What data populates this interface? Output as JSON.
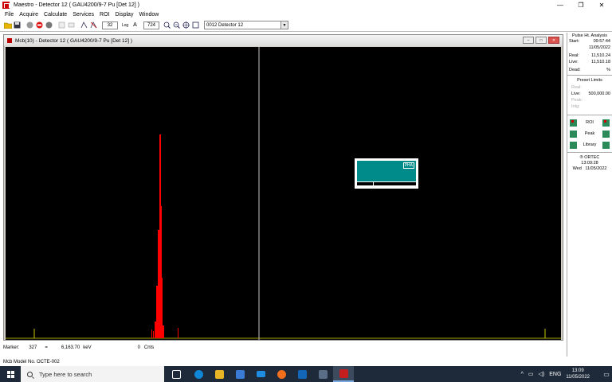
{
  "app": {
    "title": "Maestro - Detector 12 ( GAU4200/9-7 Pu [Det 12] )",
    "window_controls": {
      "minimize": "—",
      "restore": "❐",
      "close": "✕"
    }
  },
  "menu": [
    "File",
    "Acquire",
    "Calculate",
    "Services",
    "ROI",
    "Display",
    "Window"
  ],
  "toolbar": {
    "vertical_scale": "32",
    "log_label": "Log",
    "auto_label": "A",
    "horizontal_width": "724",
    "detector_select": "0012  Detector 12",
    "dropdown_arrow": "▼"
  },
  "mcb_window": {
    "title": "Mcb(10) - Detector 12 ( GAU4200/9-7 Pu [Det 12] )",
    "controls": {
      "minimize": "–",
      "restore": "□",
      "close": "✕"
    },
    "inset_label": "PHA"
  },
  "status": {
    "marker_label": "Marker:",
    "marker_channel": "327",
    "equals": "=",
    "energy": "6,163.70",
    "energy_unit": "keV",
    "counts": "0",
    "counts_unit": "Cnts",
    "model": "Mcb Model No. OCTE-002"
  },
  "right_panel": {
    "title": "Pulse Ht. Analysis",
    "start_label": "Start:",
    "start_time": "09:57:44",
    "start_date": "11/05/2022",
    "real_label": "Real:",
    "real_value": "11,510.24",
    "live_label": "Live:",
    "live_value": "11,510.18",
    "dead_label": "Dead:",
    "dead_value": "%",
    "preset_title": "Preset Limits",
    "preset_real": "Real:",
    "preset_live_label": "Live:",
    "preset_live_value": "500,000.00",
    "preset_peak": "Peak:",
    "preset_intg": "Intg:",
    "roi_label": "ROI",
    "peak_label": "Peak",
    "library_label": "Library",
    "logo": "® ORTEC",
    "panel_time": "13:09:28",
    "panel_day": "Wed",
    "panel_date": "11/05/2022"
  },
  "taskbar": {
    "search_placeholder": "Type here to search",
    "language": "ENG",
    "time": "13:09",
    "date": "11/05/2022",
    "tray_chevron": "^",
    "notification_icon": "▭"
  },
  "colors": {
    "spectrum_peak": "#ff0000",
    "spectrum_bg": "#000000",
    "inset_fill": "#008b8b",
    "taskbar_bg": "#1e2a3a"
  }
}
